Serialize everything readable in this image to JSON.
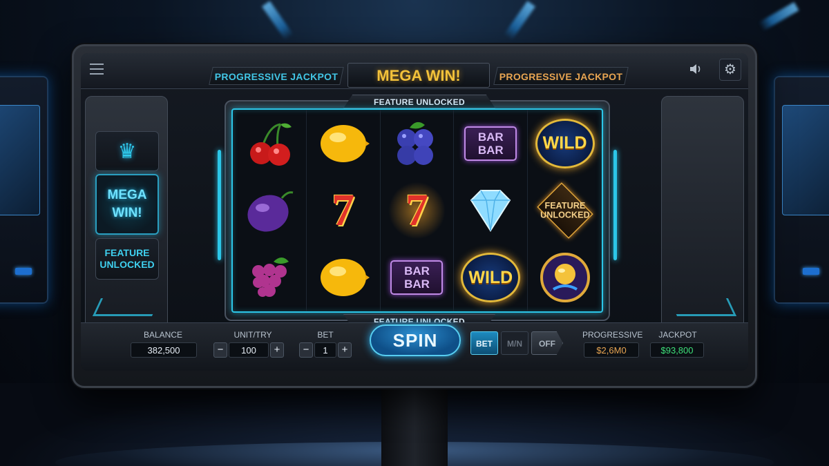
{
  "topbar": {
    "left_label": "PROGRESSIVE JACKPOT",
    "center_title": "MEGA WIN!",
    "right_label": "PROGRESSIVE JACKPOT"
  },
  "left_panel": {
    "mega_win": "MEGA\nWIN!",
    "feature": "FEATURE\nUNLOCKED"
  },
  "reels": {
    "top_tab": "FEATURE UNLOCKED",
    "bottom_tab": "FEATURE UNLOCKED",
    "grid": [
      [
        "cherries",
        "lemon",
        "blueberries",
        "bar",
        "wild"
      ],
      [
        "plum",
        "seven",
        "seven-glow",
        "diamond",
        "feature"
      ],
      [
        "grapes",
        "lemon",
        "bar",
        "wild",
        "golden-orb"
      ]
    ],
    "bar_text": [
      "BAR",
      "BAR"
    ],
    "wild_text": "WILD",
    "feature_text": "FEATURE\nUNLOCKED",
    "seven_text": "7"
  },
  "controls": {
    "balance_label": "BALANCE",
    "balance_value": "382,500",
    "unit_label": "UNIT/TRY",
    "unit_value": "100",
    "bet_label": "BET",
    "bet_value": "1",
    "minus": "−",
    "plus": "+",
    "spin_label": "SPIN",
    "bet_toggle": "BET",
    "man_toggle": "M/N",
    "off_toggle": "OFF",
    "progressive_label": "PROGRESSIVE",
    "progressive_value": "$2,6M0",
    "jackpot_label": "JACKPOT",
    "jackpot_value": "$93,800"
  },
  "colors": {
    "accent": "#2cc6e8",
    "gold": "#f3c23a",
    "progressive": "#e8a552",
    "jackpot": "#3ee07a"
  },
  "icons": [
    "menu-icon",
    "volume-icon",
    "gear-icon",
    "crown-icon"
  ]
}
